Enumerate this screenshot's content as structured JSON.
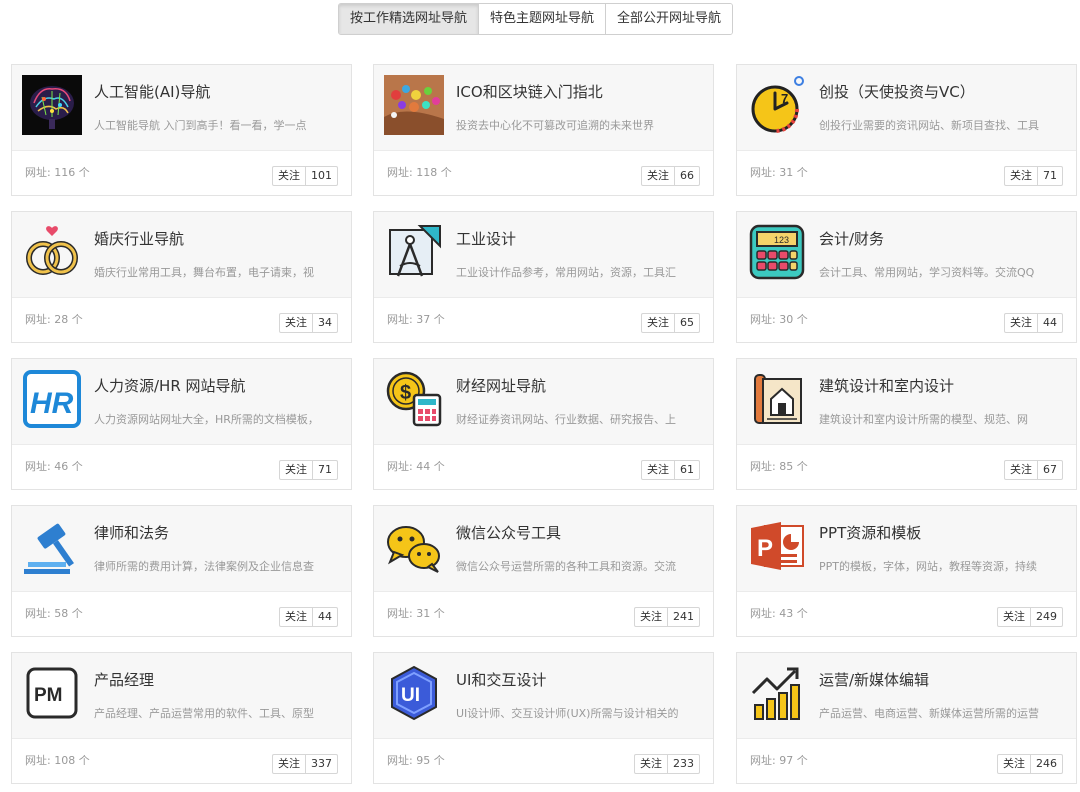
{
  "tabs": [
    {
      "label": "按工作精选网址导航",
      "active": true
    },
    {
      "label": "特色主题网址导航",
      "active": false
    },
    {
      "label": "全部公开网址导航",
      "active": false
    }
  ],
  "follow_label": "关注",
  "cards": [
    {
      "title": "人工智能(AI)导航",
      "desc": "人工智能导航 入门到高手！看一看，学一点",
      "count": "网址: 116 个",
      "follows": "101",
      "icon": "ai-brain-icon"
    },
    {
      "title": "ICO和区块链入门指北",
      "desc": "投资去中心化不可篡改可追溯的未来世界",
      "count": "网址: 118 个",
      "follows": "66",
      "icon": "colorful-pebbles-icon"
    },
    {
      "title": "创投（天使投资与VC）",
      "desc": "创投行业需要的资讯网站、新项目查找、工具",
      "count": "网址: 31 个",
      "follows": "71",
      "icon": "clock-icon"
    },
    {
      "title": "婚庆行业导航",
      "desc": "婚庆行业常用工具，舞台布置，电子请柬，视",
      "count": "网址: 28 个",
      "follows": "34",
      "icon": "wedding-rings-icon"
    },
    {
      "title": "工业设计",
      "desc": "工业设计作品参考，常用网站，资源，工具汇",
      "count": "网址: 37 个",
      "follows": "65",
      "icon": "drafting-compass-icon"
    },
    {
      "title": "会计/财务",
      "desc": "会计工具、常用网站，学习资料等。交流QQ",
      "count": "网址: 30 个",
      "follows": "44",
      "icon": "calculator-icon"
    },
    {
      "title": "人力资源/HR 网站导航",
      "desc": "人力资源网站网址大全，HR所需的文档模板，",
      "count": "网址: 46 个",
      "follows": "71",
      "icon": "hr-icon"
    },
    {
      "title": "财经网址导航",
      "desc": "财经证券资讯网站、行业数据、研究报告、上",
      "count": "网址: 44 个",
      "follows": "61",
      "icon": "coin-calculator-icon"
    },
    {
      "title": "建筑设计和室内设计",
      "desc": "建筑设计和室内设计所需的模型、规范、网",
      "count": "网址: 85 个",
      "follows": "67",
      "icon": "blueprint-house-icon"
    },
    {
      "title": "律师和法务",
      "desc": "律师所需的费用计算，法律案例及企业信息查",
      "count": "网址: 58 个",
      "follows": "44",
      "icon": "gavel-icon"
    },
    {
      "title": "微信公众号工具",
      "desc": "微信公众号运营所需的各种工具和资源。交流",
      "count": "网址: 31 个",
      "follows": "241",
      "icon": "wechat-bubbles-icon"
    },
    {
      "title": "PPT资源和模板",
      "desc": "PPT的模板，字体，网站，教程等资源，持续",
      "count": "网址: 43 个",
      "follows": "249",
      "icon": "powerpoint-icon"
    },
    {
      "title": "产品经理",
      "desc": "产品经理、产品运营常用的软件、工具、原型",
      "count": "网址: 108 个",
      "follows": "337",
      "icon": "pm-icon"
    },
    {
      "title": "UI和交互设计",
      "desc": "UI设计师、交互设计师(UX)所需与设计相关的",
      "count": "网址: 95 个",
      "follows": "233",
      "icon": "ui-hexagon-icon"
    },
    {
      "title": "运营/新媒体编辑",
      "desc": "产品运营、电商运营、新媒体运营所需的运营",
      "count": "网址: 97 个",
      "follows": "246",
      "icon": "growth-chart-icon"
    }
  ],
  "icon_texts": {
    "clock": "7",
    "calculator": "123",
    "hr": "HR",
    "coin": "$",
    "powerpoint": "P",
    "pm": "PM",
    "ui": "UI"
  },
  "colors": {
    "tab_active_bg": "#e6e6e6",
    "card_top_bg": "#f7f7f7",
    "hr_blue": "#1e88d8",
    "ppt_orange": "#d04a2a",
    "ui_blue": "#3b5bd9",
    "gavel_blue": "#2e7fd0"
  }
}
